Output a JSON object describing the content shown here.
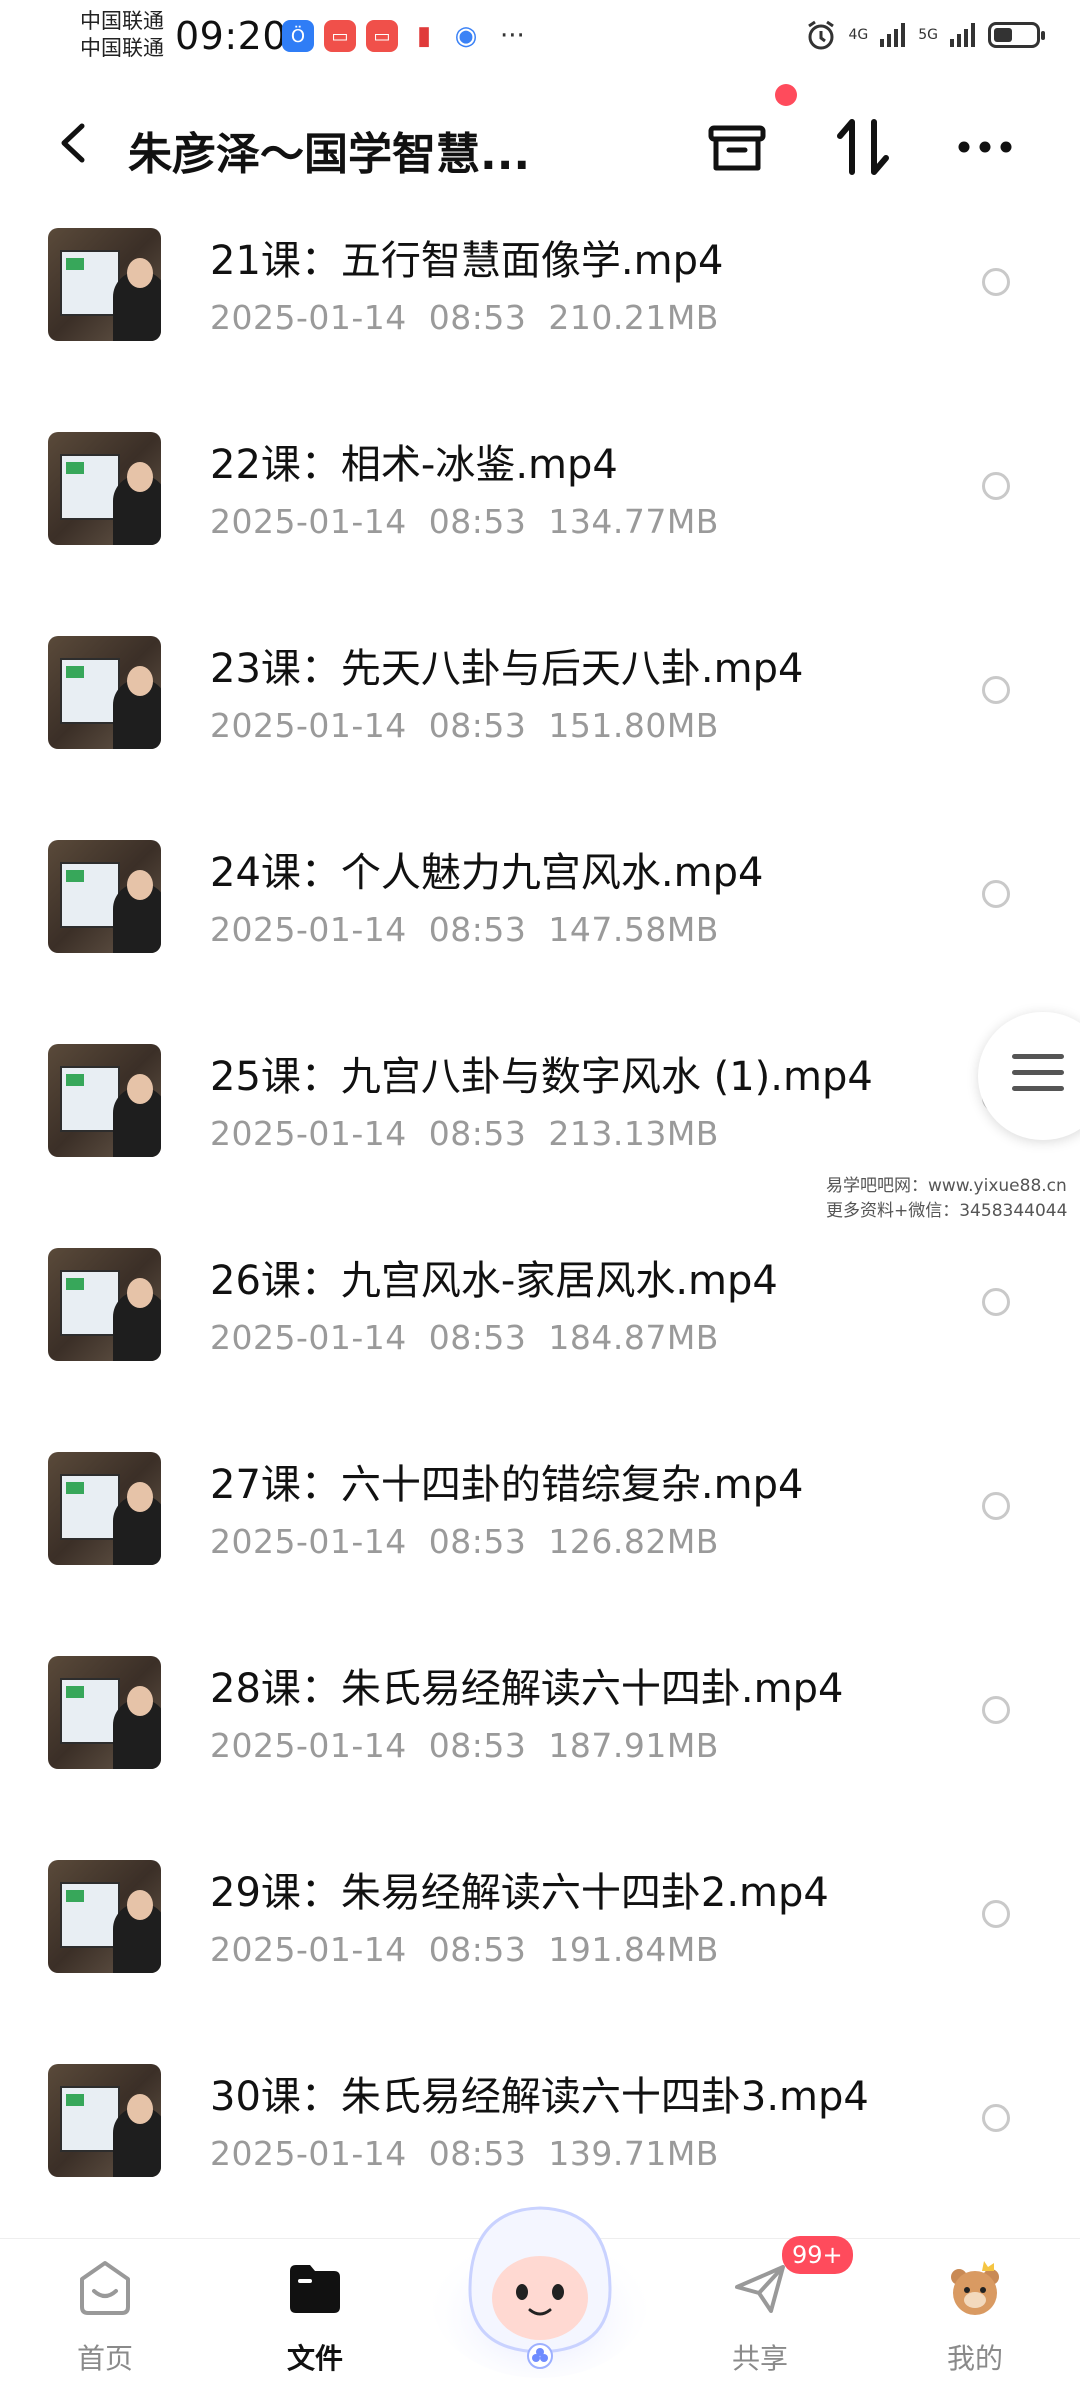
{
  "status_bar": {
    "carrier_1": "中国联通",
    "carrier_2": "中国联通",
    "time": "09:20",
    "network_1": "4G",
    "network_2": "5G"
  },
  "header": {
    "title": "朱彦泽～国学智慧..."
  },
  "files": [
    {
      "name": "21课：五行智慧面像学.mp4",
      "date": "2025-01-14",
      "time": "08:53",
      "size": "210.21MB"
    },
    {
      "name": "22课：相术-冰鉴.mp4",
      "date": "2025-01-14",
      "time": "08:53",
      "size": "134.77MB"
    },
    {
      "name": "23课：先天八卦与后天八卦.mp4",
      "date": "2025-01-14",
      "time": "08:53",
      "size": "151.80MB"
    },
    {
      "name": "24课：个人魅力九宫风水.mp4",
      "date": "2025-01-14",
      "time": "08:53",
      "size": "147.58MB"
    },
    {
      "name": "25课：九宫八卦与数字风水 (1).mp4",
      "date": "2025-01-14",
      "time": "08:53",
      "size": "213.13MB"
    },
    {
      "name": "26课：九宫风水-家居风水.mp4",
      "date": "2025-01-14",
      "time": "08:53",
      "size": "184.87MB"
    },
    {
      "name": "27课：六十四卦的错综复杂.mp4",
      "date": "2025-01-14",
      "time": "08:53",
      "size": "126.82MB"
    },
    {
      "name": "28课：朱氏易经解读六十四卦.mp4",
      "date": "2025-01-14",
      "time": "08:53",
      "size": "187.91MB"
    },
    {
      "name": "29课：朱易经解读六十四卦2.mp4",
      "date": "2025-01-14",
      "time": "08:53",
      "size": "191.84MB"
    },
    {
      "name": "30课：朱氏易经解读六十四卦3.mp4",
      "date": "2025-01-14",
      "time": "08:53",
      "size": "139.71MB"
    }
  ],
  "watermark": {
    "line1": "易学吧吧网：www.yixue88.cn",
    "line2": "更多资料+微信：3458344044"
  },
  "bottom_nav": {
    "home": "首页",
    "files": "文件",
    "share": "共享",
    "share_badge": "99+",
    "mine": "我的"
  },
  "colors": {
    "accent_red": "#ff4b5c",
    "meta_gray": "#9a9a9a"
  }
}
